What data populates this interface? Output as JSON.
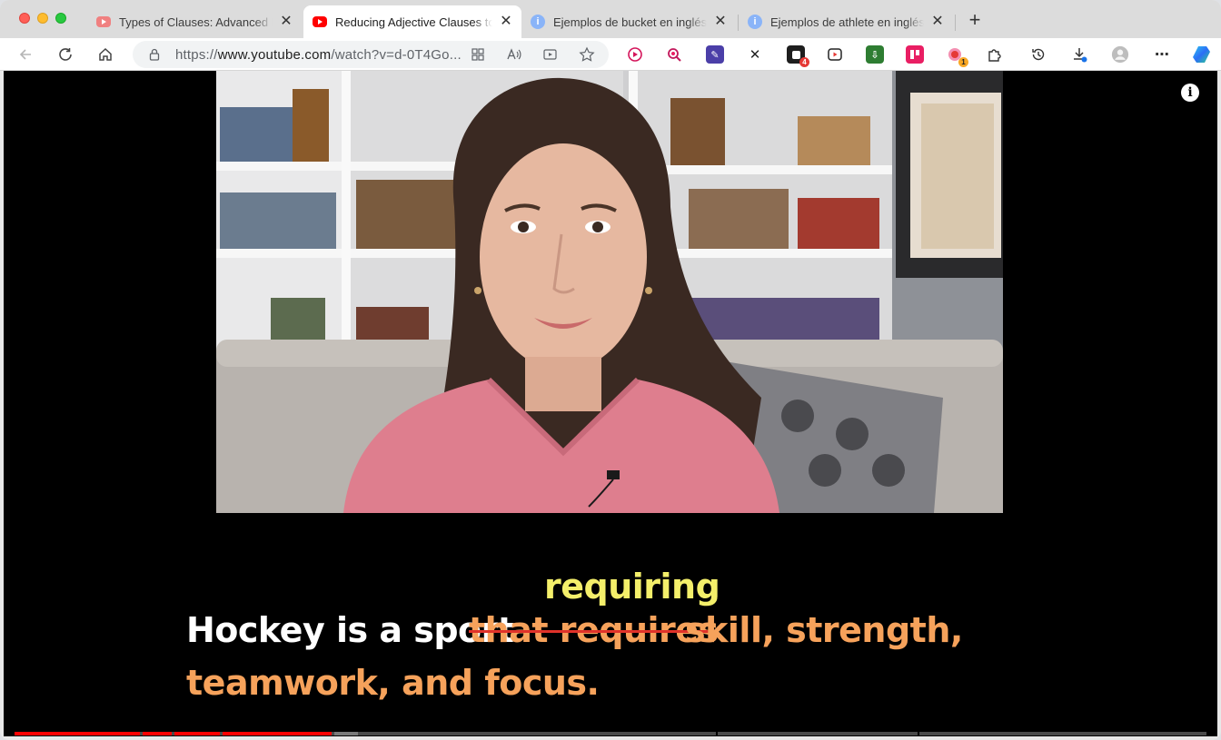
{
  "tabs": [
    {
      "title": "Types of Clauses: Advanced English",
      "favicon": "youtube-icon",
      "active": false
    },
    {
      "title": "Reducing Adjective Clauses to",
      "favicon": "youtube-icon",
      "active": true
    },
    {
      "title": "Ejemplos de bucket en inglés |",
      "favicon": "info-icon",
      "active": false
    },
    {
      "title": "Ejemplos de athlete en inglés |",
      "favicon": "info-icon",
      "active": false
    }
  ],
  "address_bar": {
    "scheme": "https://",
    "host": "www.youtube.com",
    "path": "/watch?v=d-0T4Go..."
  },
  "extensions": {
    "badge_1": "4",
    "badge_2": "1"
  },
  "video": {
    "caption_line1_start": "Hockey is a sport",
    "caption_struck": "that requires",
    "caption_line1_end": "skill, strength,",
    "caption_replacement": "requiring",
    "caption_line2": "teamwork, and focus.",
    "info_label": "i"
  },
  "colors": {
    "caption_white": "#ffffff",
    "caption_orange": "#f6a25b",
    "caption_yellow": "#f4ef6a",
    "strike_red": "#e0322a",
    "progress_red": "#ff0000"
  }
}
